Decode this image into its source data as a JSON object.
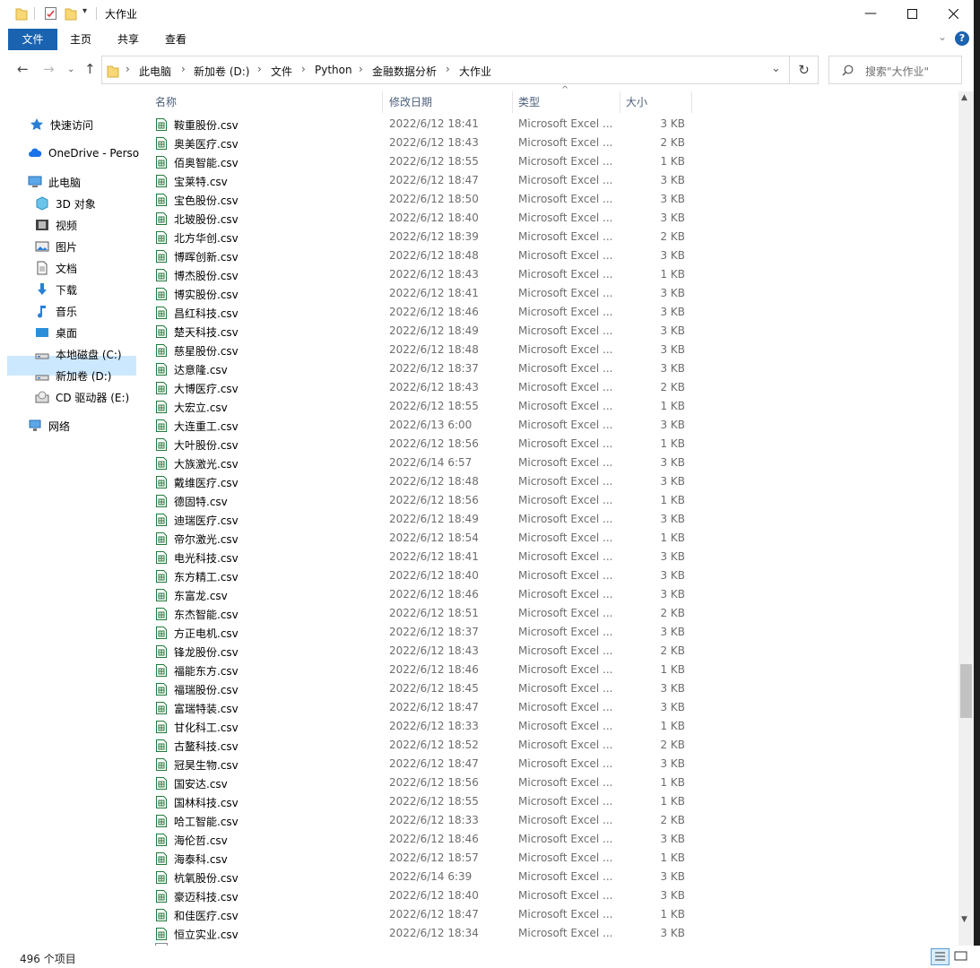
{
  "window": {
    "title": "大作业"
  },
  "ribbon": {
    "tabs": [
      "文件",
      "主页",
      "共享",
      "查看"
    ]
  },
  "address": {
    "crumbs": [
      "此电脑",
      "新加卷 (D:)",
      "文件",
      "Python",
      "金融数据分析",
      "大作业"
    ],
    "sep": "›"
  },
  "search": {
    "placeholder": "搜索\"大作业\""
  },
  "sidebar": {
    "items": [
      {
        "label": "快速访问",
        "icon": "star-icon"
      },
      {
        "label": "OneDrive - Perso",
        "icon": "cloud-icon"
      },
      {
        "label": "此电脑",
        "icon": "computer-icon"
      },
      {
        "label": "3D 对象",
        "icon": "cube-icon"
      },
      {
        "label": "视频",
        "icon": "video-icon"
      },
      {
        "label": "图片",
        "icon": "picture-icon"
      },
      {
        "label": "文档",
        "icon": "document-icon"
      },
      {
        "label": "下载",
        "icon": "download-icon"
      },
      {
        "label": "音乐",
        "icon": "music-icon"
      },
      {
        "label": "桌面",
        "icon": "desktop-icon"
      },
      {
        "label": "本地磁盘 (C:)",
        "icon": "drive-icon"
      },
      {
        "label": "新加卷 (D:)",
        "icon": "drive-icon"
      },
      {
        "label": "CD 驱动器 (E:)",
        "icon": "cd-icon"
      },
      {
        "label": "网络",
        "icon": "network-icon"
      }
    ]
  },
  "columns": {
    "name": "名称",
    "date": "修改日期",
    "type": "类型",
    "size": "大小"
  },
  "files": [
    {
      "name": "鞍重股份.csv",
      "date": "2022/6/12 18:41",
      "type": "Microsoft Excel ...",
      "size": "3 KB"
    },
    {
      "name": "奥美医疗.csv",
      "date": "2022/6/12 18:43",
      "type": "Microsoft Excel ...",
      "size": "2 KB"
    },
    {
      "name": "佰奥智能.csv",
      "date": "2022/6/12 18:55",
      "type": "Microsoft Excel ...",
      "size": "1 KB"
    },
    {
      "name": "宝莱特.csv",
      "date": "2022/6/12 18:47",
      "type": "Microsoft Excel ...",
      "size": "3 KB"
    },
    {
      "name": "宝色股份.csv",
      "date": "2022/6/12 18:50",
      "type": "Microsoft Excel ...",
      "size": "3 KB"
    },
    {
      "name": "北玻股份.csv",
      "date": "2022/6/12 18:40",
      "type": "Microsoft Excel ...",
      "size": "3 KB"
    },
    {
      "name": "北方华创.csv",
      "date": "2022/6/12 18:39",
      "type": "Microsoft Excel ...",
      "size": "2 KB"
    },
    {
      "name": "博晖创新.csv",
      "date": "2022/6/12 18:48",
      "type": "Microsoft Excel ...",
      "size": "3 KB"
    },
    {
      "name": "博杰股份.csv",
      "date": "2022/6/12 18:43",
      "type": "Microsoft Excel ...",
      "size": "1 KB"
    },
    {
      "name": "博实股份.csv",
      "date": "2022/6/12 18:41",
      "type": "Microsoft Excel ...",
      "size": "3 KB"
    },
    {
      "name": "昌红科技.csv",
      "date": "2022/6/12 18:46",
      "type": "Microsoft Excel ...",
      "size": "3 KB"
    },
    {
      "name": "楚天科技.csv",
      "date": "2022/6/12 18:49",
      "type": "Microsoft Excel ...",
      "size": "3 KB"
    },
    {
      "name": "慈星股份.csv",
      "date": "2022/6/12 18:48",
      "type": "Microsoft Excel ...",
      "size": "3 KB"
    },
    {
      "name": "达意隆.csv",
      "date": "2022/6/12 18:37",
      "type": "Microsoft Excel ...",
      "size": "3 KB"
    },
    {
      "name": "大博医疗.csv",
      "date": "2022/6/12 18:43",
      "type": "Microsoft Excel ...",
      "size": "2 KB"
    },
    {
      "name": "大宏立.csv",
      "date": "2022/6/12 18:55",
      "type": "Microsoft Excel ...",
      "size": "1 KB"
    },
    {
      "name": "大连重工.csv",
      "date": "2022/6/13 6:00",
      "type": "Microsoft Excel ...",
      "size": "3 KB"
    },
    {
      "name": "大叶股份.csv",
      "date": "2022/6/12 18:56",
      "type": "Microsoft Excel ...",
      "size": "1 KB"
    },
    {
      "name": "大族激光.csv",
      "date": "2022/6/14 6:57",
      "type": "Microsoft Excel ...",
      "size": "3 KB"
    },
    {
      "name": "戴维医疗.csv",
      "date": "2022/6/12 18:48",
      "type": "Microsoft Excel ...",
      "size": "3 KB"
    },
    {
      "name": "德固特.csv",
      "date": "2022/6/12 18:56",
      "type": "Microsoft Excel ...",
      "size": "1 KB"
    },
    {
      "name": "迪瑞医疗.csv",
      "date": "2022/6/12 18:49",
      "type": "Microsoft Excel ...",
      "size": "3 KB"
    },
    {
      "name": "帝尔激光.csv",
      "date": "2022/6/12 18:54",
      "type": "Microsoft Excel ...",
      "size": "1 KB"
    },
    {
      "name": "电光科技.csv",
      "date": "2022/6/12 18:41",
      "type": "Microsoft Excel ...",
      "size": "3 KB"
    },
    {
      "name": "东方精工.csv",
      "date": "2022/6/12 18:40",
      "type": "Microsoft Excel ...",
      "size": "3 KB"
    },
    {
      "name": "东富龙.csv",
      "date": "2022/6/12 18:46",
      "type": "Microsoft Excel ...",
      "size": "3 KB"
    },
    {
      "name": "东杰智能.csv",
      "date": "2022/6/12 18:51",
      "type": "Microsoft Excel ...",
      "size": "2 KB"
    },
    {
      "name": "方正电机.csv",
      "date": "2022/6/12 18:37",
      "type": "Microsoft Excel ...",
      "size": "3 KB"
    },
    {
      "name": "锋龙股份.csv",
      "date": "2022/6/12 18:43",
      "type": "Microsoft Excel ...",
      "size": "2 KB"
    },
    {
      "name": "福能东方.csv",
      "date": "2022/6/12 18:46",
      "type": "Microsoft Excel ...",
      "size": "1 KB"
    },
    {
      "name": "福瑞股份.csv",
      "date": "2022/6/12 18:45",
      "type": "Microsoft Excel ...",
      "size": "3 KB"
    },
    {
      "name": "富瑞特装.csv",
      "date": "2022/6/12 18:47",
      "type": "Microsoft Excel ...",
      "size": "3 KB"
    },
    {
      "name": "甘化科工.csv",
      "date": "2022/6/12 18:33",
      "type": "Microsoft Excel ...",
      "size": "1 KB"
    },
    {
      "name": "古鳌科技.csv",
      "date": "2022/6/12 18:52",
      "type": "Microsoft Excel ...",
      "size": "2 KB"
    },
    {
      "name": "冠昊生物.csv",
      "date": "2022/6/12 18:47",
      "type": "Microsoft Excel ...",
      "size": "3 KB"
    },
    {
      "name": "国安达.csv",
      "date": "2022/6/12 18:56",
      "type": "Microsoft Excel ...",
      "size": "1 KB"
    },
    {
      "name": "国林科技.csv",
      "date": "2022/6/12 18:55",
      "type": "Microsoft Excel ...",
      "size": "1 KB"
    },
    {
      "name": "哈工智能.csv",
      "date": "2022/6/12 18:33",
      "type": "Microsoft Excel ...",
      "size": "2 KB"
    },
    {
      "name": "海伦哲.csv",
      "date": "2022/6/12 18:46",
      "type": "Microsoft Excel ...",
      "size": "3 KB"
    },
    {
      "name": "海泰科.csv",
      "date": "2022/6/12 18:57",
      "type": "Microsoft Excel ...",
      "size": "1 KB"
    },
    {
      "name": "杭氧股份.csv",
      "date": "2022/6/14 6:39",
      "type": "Microsoft Excel ...",
      "size": "3 KB"
    },
    {
      "name": "豪迈科技.csv",
      "date": "2022/6/12 18:40",
      "type": "Microsoft Excel ...",
      "size": "3 KB"
    },
    {
      "name": "和佳医疗.csv",
      "date": "2022/6/12 18:47",
      "type": "Microsoft Excel ...",
      "size": "1 KB"
    },
    {
      "name": "恒立实业.csv",
      "date": "2022/6/12 18:34",
      "type": "Microsoft Excel ...",
      "size": "3 KB"
    }
  ],
  "status": {
    "count": "496 个项目"
  }
}
